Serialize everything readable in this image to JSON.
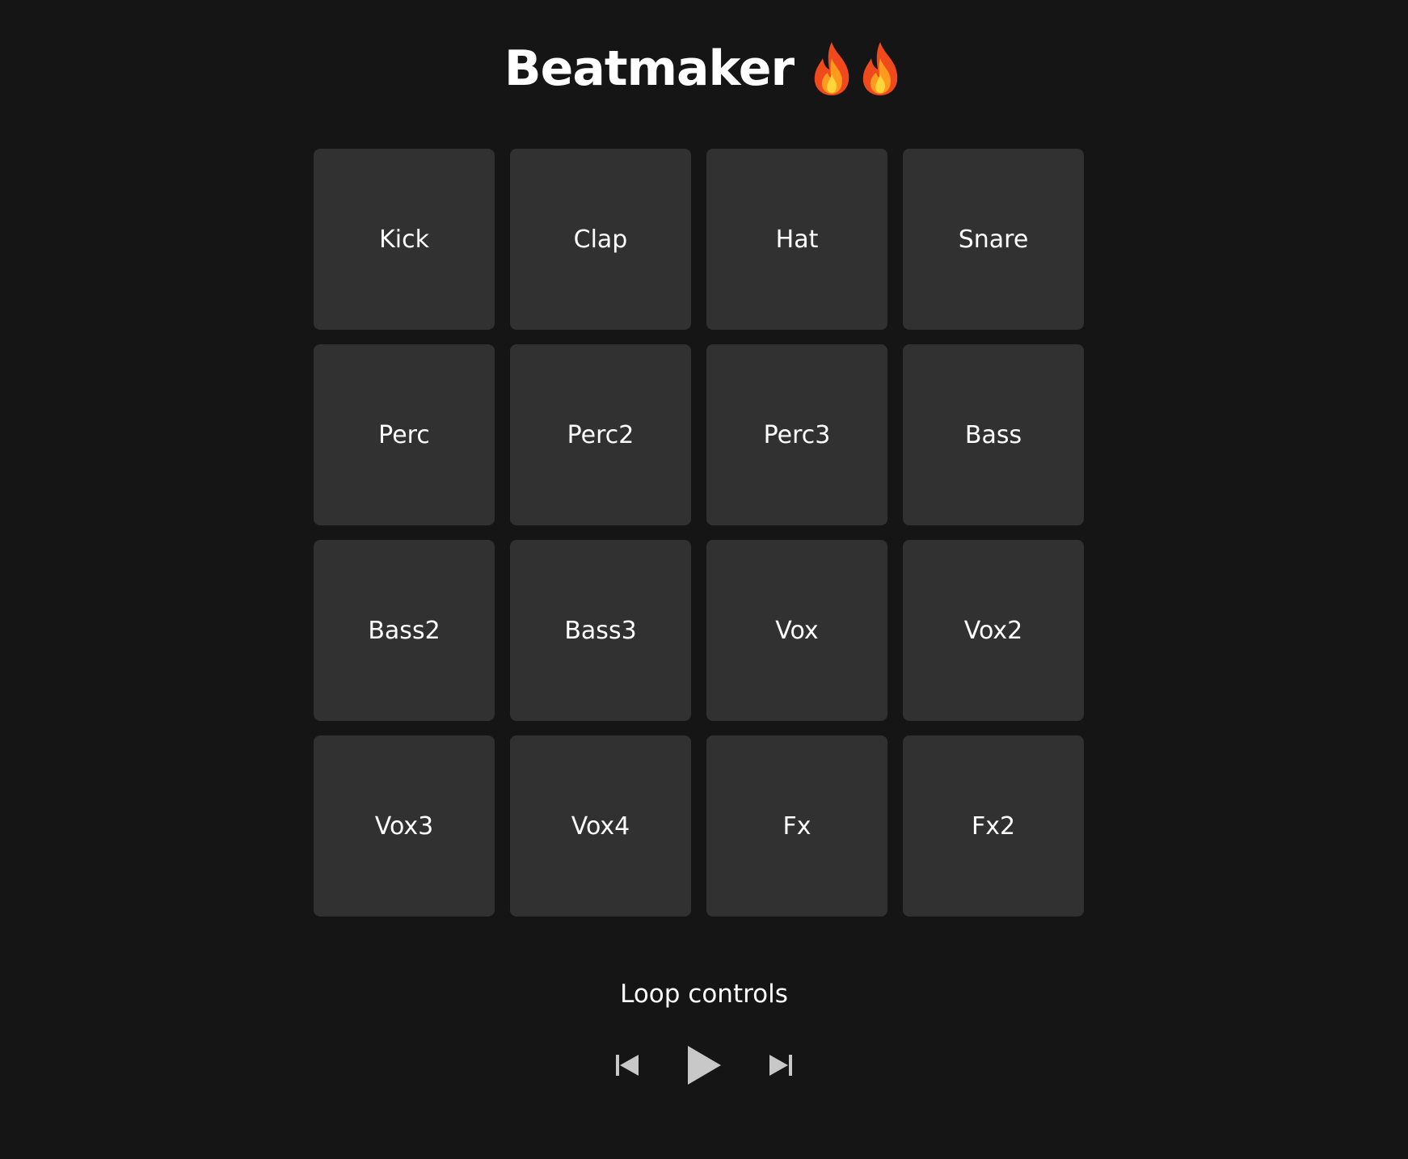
{
  "header": {
    "title": "Beatmaker",
    "icons": [
      "fire-icon",
      "fire-icon"
    ]
  },
  "pads": [
    {
      "label": "Kick"
    },
    {
      "label": "Clap"
    },
    {
      "label": "Hat"
    },
    {
      "label": "Snare"
    },
    {
      "label": "Perc"
    },
    {
      "label": "Perc2"
    },
    {
      "label": "Perc3"
    },
    {
      "label": "Bass"
    },
    {
      "label": "Bass2"
    },
    {
      "label": "Bass3"
    },
    {
      "label": "Vox"
    },
    {
      "label": "Vox2"
    },
    {
      "label": "Vox3"
    },
    {
      "label": "Vox4"
    },
    {
      "label": "Fx"
    },
    {
      "label": "Fx2"
    }
  ],
  "loop": {
    "label": "Loop controls",
    "controls": [
      "skip-previous-icon",
      "play-icon",
      "skip-next-icon"
    ]
  },
  "colors": {
    "background": "#151515",
    "pad": "#313131",
    "text": "#ffffff",
    "control": "#c8c8c8"
  }
}
